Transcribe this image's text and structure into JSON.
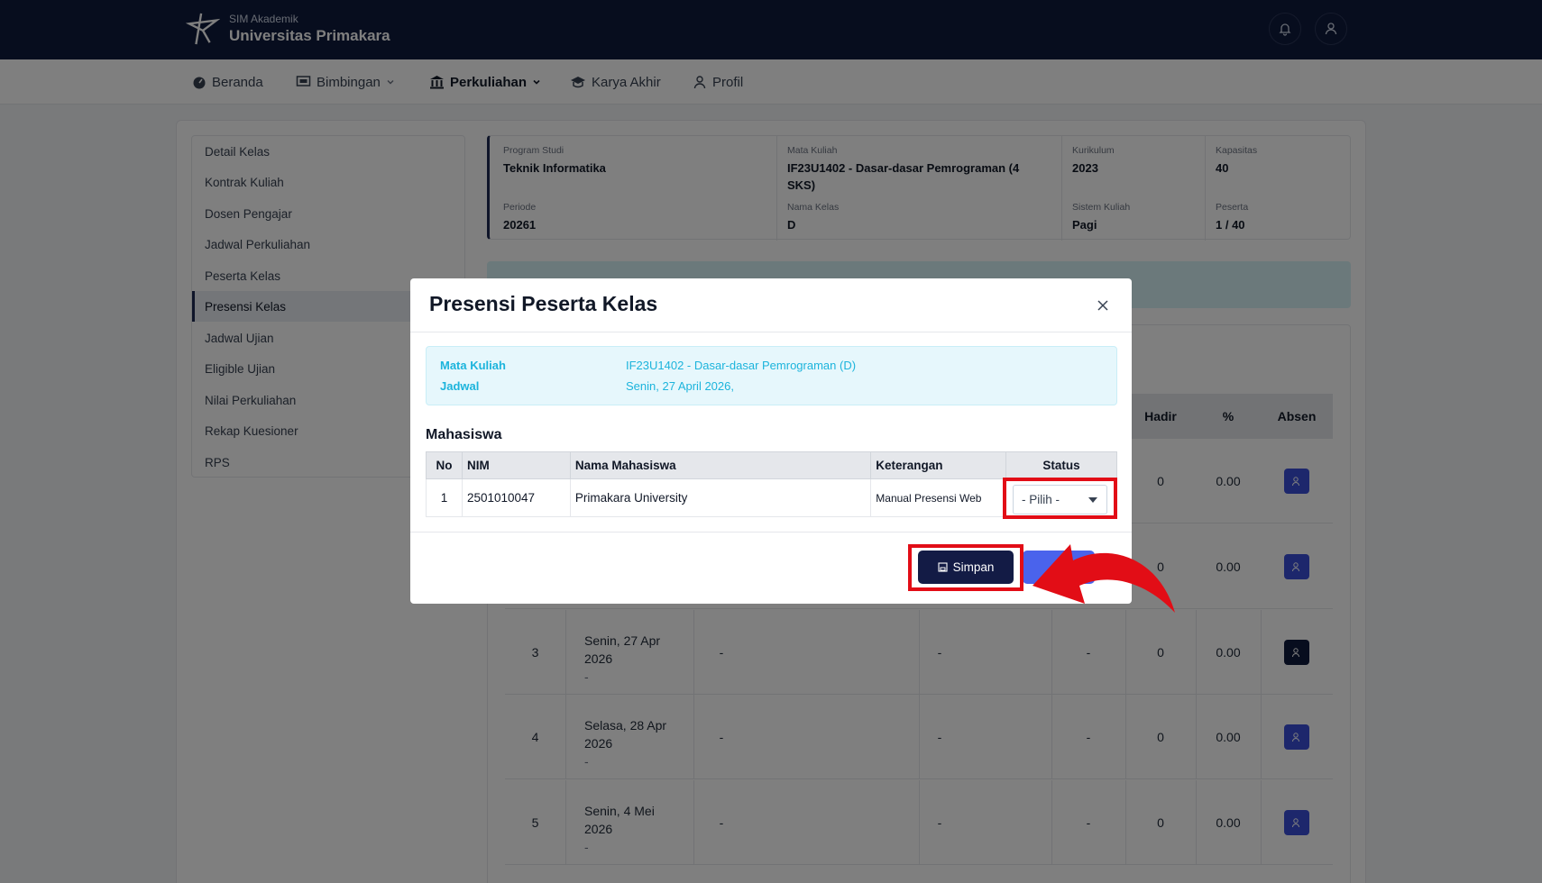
{
  "header": {
    "app_small": "SIM Akademik",
    "app_name": "Universitas Primakara",
    "icons": [
      "bell-icon",
      "user-icon"
    ]
  },
  "nav": {
    "items": [
      {
        "label": "Beranda",
        "icon": "dashboard-icon"
      },
      {
        "label": "Bimbingan",
        "icon": "presentation-icon",
        "dropdown": true
      },
      {
        "label": "Perkuliahan",
        "icon": "institution-icon",
        "dropdown": true,
        "active": true
      },
      {
        "label": "Karya Akhir",
        "icon": "graduation-cap-icon"
      },
      {
        "label": "Profil",
        "icon": "user-icon"
      }
    ]
  },
  "sidebar": {
    "items": [
      {
        "label": "Detail Kelas"
      },
      {
        "label": "Kontrak Kuliah"
      },
      {
        "label": "Dosen Pengajar"
      },
      {
        "label": "Jadwal Perkuliahan"
      },
      {
        "label": "Peserta Kelas"
      },
      {
        "label": "Presensi Kelas",
        "active": true
      },
      {
        "label": "Jadwal Ujian"
      },
      {
        "label": "Eligible Ujian"
      },
      {
        "label": "Nilai Perkuliahan"
      },
      {
        "label": "Rekap Kuesioner"
      },
      {
        "label": "RPS"
      }
    ]
  },
  "class_info": {
    "program_studi_label": "Program Studi",
    "program_studi": "Teknik Informatika",
    "mata_kuliah_label": "Mata Kuliah",
    "mata_kuliah": "IF23U1402 - Dasar-dasar Pemrograman (4 SKS)",
    "kurikulum_label": "Kurikulum",
    "kurikulum": "2023",
    "kapasitas_label": "Kapasitas",
    "kapasitas": "40",
    "periode_label": "Periode",
    "periode": "20261",
    "nama_kelas_label": "Nama Kelas",
    "nama_kelas": "D",
    "sistem_kuliah_label": "Sistem Kuliah",
    "sistem_kuliah": "Pagi",
    "peserta_label": "Peserta",
    "peserta": "1 / 40"
  },
  "schedule_table": {
    "headers": {
      "hadir": "Hadir",
      "persen": "%",
      "absen": "Absen"
    },
    "rows": [
      {
        "hadir": "0",
        "persen": "0.00"
      },
      {
        "hadir": "0",
        "persen": "0.00"
      },
      {
        "no": "3",
        "date1": "Senin, 27 Apr",
        "date2": "2026",
        "date3": "-",
        "c1": "-",
        "c2": "-",
        "c3": "-",
        "hadir": "0",
        "persen": "0.00"
      },
      {
        "no": "4",
        "date1": "Selasa, 28 Apr",
        "date2": "2026",
        "date3": "-",
        "c1": "-",
        "c2": "-",
        "c3": "-",
        "hadir": "0",
        "persen": "0.00"
      },
      {
        "no": "5",
        "date1": "Senin, 4 Mei",
        "date2": "2026",
        "date3": "-",
        "c1": "-",
        "c2": "-",
        "c3": "-",
        "hadir": "0",
        "persen": "0.00"
      }
    ]
  },
  "modal": {
    "title": "Presensi Peserta Kelas",
    "course_label": "Mata Kuliah",
    "course_value": "IF23U1402 - Dasar-dasar Pemrograman (D)",
    "schedule_label": "Jadwal",
    "schedule_value": "Senin, 27 April 2026,",
    "section_title": "Mahasiswa",
    "table_headers": {
      "no": "No",
      "nim": "NIM",
      "nama": "Nama Mahasiswa",
      "keterangan": "Keterangan",
      "status": "Status"
    },
    "students": [
      {
        "no": "1",
        "nim": "2501010047",
        "nama": "Primakara University",
        "keterangan": "Manual Presensi Web",
        "status": "- Pilih -"
      }
    ],
    "save_label": "Simpan"
  },
  "colors": {
    "header_bg": "#0f1a3c",
    "accent": "#131b45",
    "info_text": "#1cb4dc",
    "highlight": "#e20d16",
    "absen_btn": "#3b4fd8"
  }
}
